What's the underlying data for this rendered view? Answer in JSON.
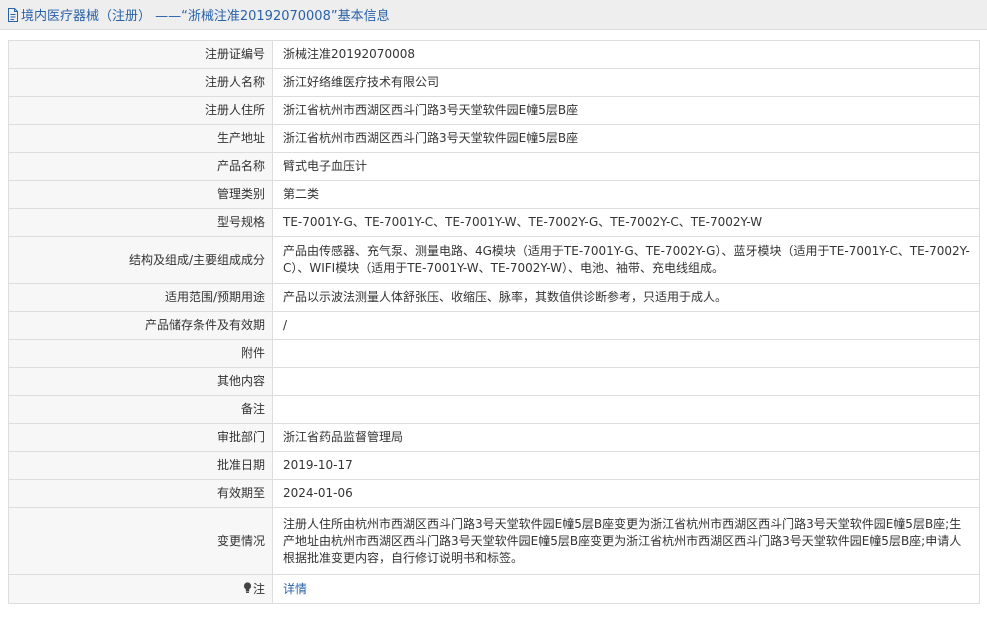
{
  "header": {
    "icon": "document-icon",
    "title": "境内医疗器械（注册）  ——“浙械注准20192070008”基本信息",
    "color": "#2a62a8"
  },
  "rows": [
    {
      "label": "注册证编号",
      "value": "浙械注准20192070008"
    },
    {
      "label": "注册人名称",
      "value": "浙江好络维医疗技术有限公司"
    },
    {
      "label": "注册人住所",
      "value": "浙江省杭州市西湖区西斗门路3号天堂软件园E幢5层B座"
    },
    {
      "label": "生产地址",
      "value": "浙江省杭州市西湖区西斗门路3号天堂软件园E幢5层B座"
    },
    {
      "label": "产品名称",
      "value": "臂式电子血压计"
    },
    {
      "label": "管理类别",
      "value": "第二类"
    },
    {
      "label": "型号规格",
      "value": "TE-7001Y-G、TE-7001Y-C、TE-7001Y-W、TE-7002Y-G、TE-7002Y-C、TE-7002Y-W"
    },
    {
      "label": "结构及组成/主要组成成分",
      "value": "产品由传感器、充气泵、测量电路、4G模块（适用于TE-7001Y-G、TE-7002Y-G）、蓝牙模块（适用于TE-7001Y-C、TE-7002Y-C）、WIFI模块（适用于TE-7001Y-W、TE-7002Y-W）、电池、袖带、充电线组成。"
    },
    {
      "label": "适用范围/预期用途",
      "value": "产品以示波法测量人体舒张压、收缩压、脉率，其数值供诊断参考，只适用于成人。"
    },
    {
      "label": "产品储存条件及有效期",
      "value": "/"
    },
    {
      "label": "附件",
      "value": ""
    },
    {
      "label": "其他内容",
      "value": ""
    },
    {
      "label": "备注",
      "value": ""
    },
    {
      "label": "审批部门",
      "value": "浙江省药品监督管理局"
    },
    {
      "label": "批准日期",
      "value": "2019-10-17"
    },
    {
      "label": "有效期至",
      "value": "2024-01-06"
    },
    {
      "label": "变更情况",
      "value": "注册人住所由杭州市西湖区西斗门路3号天堂软件园E幢5层B座变更为浙江省杭州市西湖区西斗门路3号天堂软件园E幢5层B座;生产地址由杭州市西湖区西斗门路3号天堂软件园E幢5层B座变更为浙江省杭州市西湖区西斗门路3号天堂软件园E幢5层B座;申请人根据批准变更内容，自行修订说明书和标签。"
    }
  ],
  "note": {
    "icon": "lightbulb-icon",
    "label": "注",
    "link_text": "详情"
  }
}
